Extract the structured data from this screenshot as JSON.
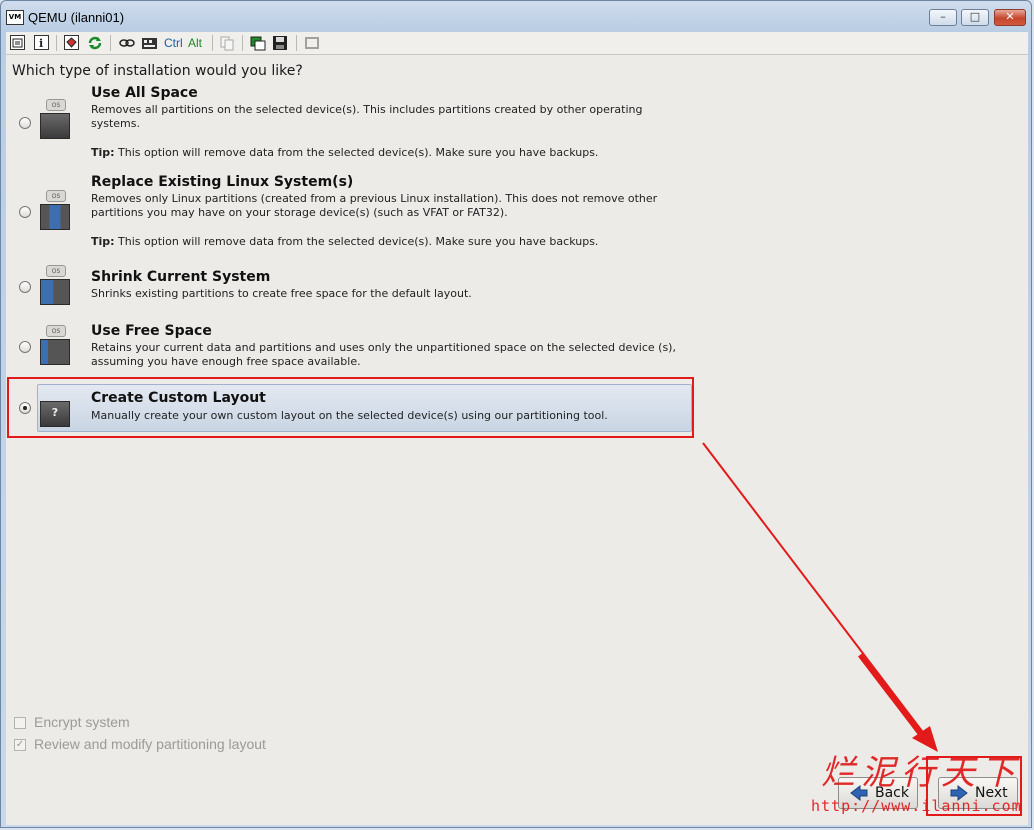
{
  "window": {
    "app_icon": "VM",
    "title": "QEMU (ilanni01)",
    "buttons": {
      "minimize": "–",
      "maximize": "□",
      "close": "✕"
    }
  },
  "toolbar": {
    "ctrl_label": "Ctrl",
    "alt_label": "Alt",
    "icons": [
      "properties-icon",
      "info-icon",
      "fullscreen-icon",
      "refresh-icon",
      "keys-icon",
      "send-keys-icon",
      "copy-icon",
      "screenshot-icon",
      "save-icon",
      "resize-icon"
    ]
  },
  "question": "Which type of installation would you like?",
  "options": [
    {
      "title": "Use All Space",
      "desc": "Removes all partitions on the selected device(s).  This includes partitions created by other operating systems.",
      "tip_label": "Tip:",
      "tip": "This option will remove data from the selected device(s).  Make sure you have backups.",
      "selected": false
    },
    {
      "title": "Replace Existing Linux System(s)",
      "desc": "Removes only Linux partitions (created from a previous Linux installation).  This does not remove other partitions you may have on your storage device(s) (such as VFAT or FAT32).",
      "tip_label": "Tip:",
      "tip": "This option will remove data from the selected device(s).  Make sure you have backups.",
      "selected": false
    },
    {
      "title": "Shrink Current System",
      "desc": "Shrinks existing partitions to create free space for the default layout.",
      "selected": false
    },
    {
      "title": "Use Free Space",
      "desc": "Retains your current data and partitions and uses only the unpartitioned space on the selected device (s), assuming you have enough free space available.",
      "selected": false
    },
    {
      "title": "Create Custom Layout",
      "desc": "Manually create your own custom layout on the selected device(s) using our partitioning tool.",
      "selected": true
    }
  ],
  "os_cap_text": "OS",
  "custom_icon_text": "?",
  "checkboxes": {
    "encrypt": {
      "label": "Encrypt system",
      "checked": false
    },
    "review": {
      "label": "Review and modify partitioning layout",
      "checked": true,
      "mark": "✓"
    }
  },
  "buttons": {
    "back": "Back",
    "next": "Next"
  },
  "watermark": {
    "chinese": "烂泥行天下",
    "url": "http://www.ilanni.com"
  },
  "colors": {
    "highlight": "#e21a1a",
    "selection": "#c9d5e4",
    "background": "#edebe8"
  }
}
